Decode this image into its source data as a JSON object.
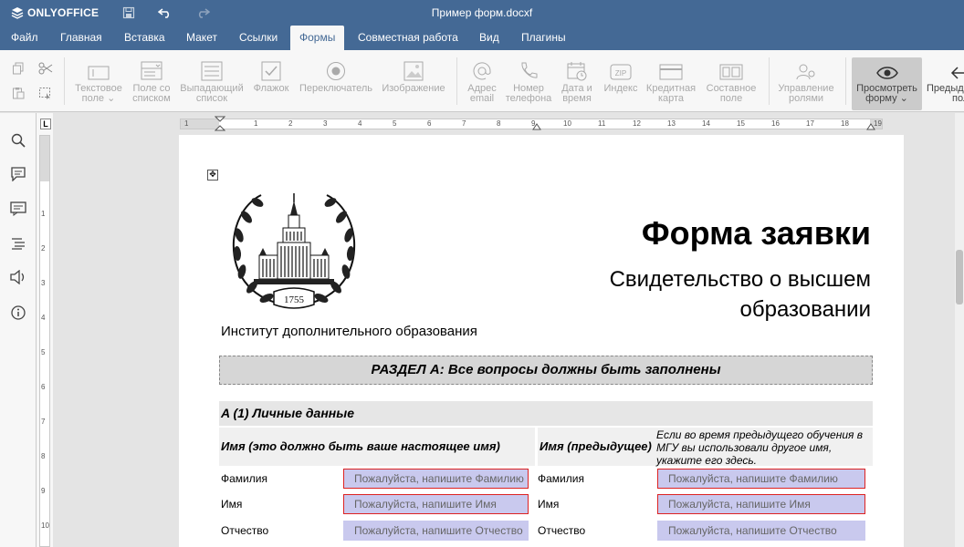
{
  "app": {
    "logo_text": "ONLYOFFICE",
    "doc_title": "Пример форм.docxf"
  },
  "menu": [
    "Файл",
    "Главная",
    "Вставка",
    "Макет",
    "Ссылки",
    "Формы",
    "Совместная работа",
    "Вид",
    "Плагины"
  ],
  "active_menu": "Формы",
  "toolbar": {
    "text_field": [
      "Текстовое",
      "поле"
    ],
    "combo_box": [
      "Поле со",
      "списком"
    ],
    "dropdown": [
      "Выпадающий",
      "список"
    ],
    "checkbox": [
      "Флажок"
    ],
    "radio": [
      "Переключатель"
    ],
    "image": [
      "Изображение"
    ],
    "email": [
      "Адрес",
      "email"
    ],
    "phone": [
      "Номер",
      "телефона"
    ],
    "datetime": [
      "Дата и",
      "время"
    ],
    "zip": [
      "Индекс"
    ],
    "credit_card": [
      "Кредитная",
      "карта"
    ],
    "complex_field": [
      "Составное",
      "поле"
    ],
    "manage_roles": [
      "Управление",
      "ролями"
    ],
    "view_form": [
      "Просмотреть",
      "форму"
    ],
    "prev_field": [
      "Предыд",
      "поле"
    ],
    "zip_glyph": "ZIP"
  },
  "ruler": {
    "corner": "L",
    "h_numbers": [
      "1",
      "1",
      "2",
      "3",
      "4",
      "5",
      "6",
      "7",
      "8",
      "9",
      "10",
      "11",
      "12",
      "13",
      "14",
      "15",
      "16",
      "17",
      "18",
      "19"
    ],
    "v_numbers": [
      "1",
      "2",
      "3",
      "4",
      "5",
      "6",
      "7",
      "8",
      "9",
      "10"
    ]
  },
  "document": {
    "move_handle": "✥",
    "emblem_year": "1755",
    "title": "Форма заявки",
    "subtitle_line1": "Свидетельство о высшем",
    "subtitle_line2": "образовании",
    "institute": "Институт дополнительного образования",
    "section_a": "РАЗДЕЛ А: Все вопросы должны быть заполнены",
    "subsection": "A (1) Личные данные",
    "col_current": "Имя (это должно быть ваше настоящее имя)",
    "col_previous": "Имя (предыдущее)",
    "col_previous_note": "Если во время предыдущего обучения в МГУ вы использовали другое имя, укажите его здесь.",
    "rows": [
      {
        "label": "Фамилия",
        "placeholder": "Пожалуйста, напишите Фамилию"
      },
      {
        "label": "Имя",
        "placeholder": "Пожалуйста, напишите Имя"
      },
      {
        "label": "Отчество",
        "placeholder": "Пожалуйста, напишите Отчество"
      }
    ],
    "rows_previous": [
      {
        "label": "Фамилия",
        "placeholder": "Пожалуйста, напишите Фамилию"
      },
      {
        "label": "Имя",
        "placeholder": "Пожалуйста, напишите Имя"
      },
      {
        "label": "Отчество",
        "placeholder": "Пожалуйста, напишите Отчество"
      }
    ]
  },
  "colors": {
    "header": "#446995",
    "toolbar": "#f7f7f7",
    "field_fill": "#c9c9ee",
    "required_border": "#dd2222"
  }
}
